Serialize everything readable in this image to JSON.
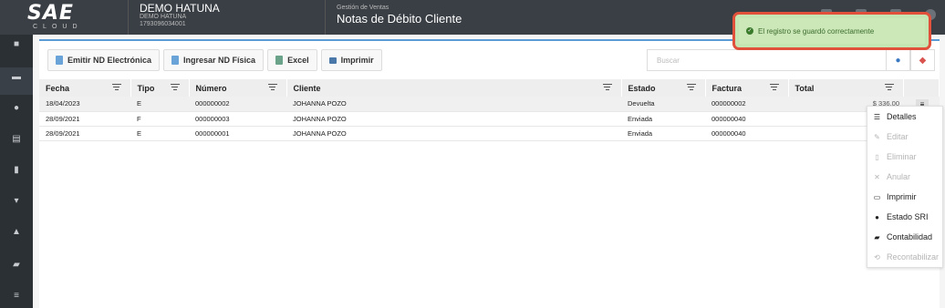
{
  "logo": {
    "main": "SAE",
    "sub": "CLOUD"
  },
  "company": {
    "name": "DEMO HATUNA",
    "sub_name": "DEMO HATUNA",
    "ruc": "1793096034001"
  },
  "module": {
    "section": "Gestión de Ventas",
    "title": "Notas de Débito Cliente"
  },
  "toolbar": {
    "emit_label": "Emitir ND Electrónica",
    "physical_label": "Ingresar ND Física",
    "excel_label": "Excel",
    "print_label": "Imprimir"
  },
  "search": {
    "placeholder": "Buscar"
  },
  "table": {
    "headers": [
      "Fecha",
      "Tipo",
      "Número",
      "Cliente",
      "Estado",
      "Factura",
      "Total"
    ],
    "rows": [
      {
        "fecha": "18/04/2023",
        "tipo": "E",
        "numero": "000000002",
        "cliente": "JOHANNA POZO",
        "estado": "Devuelta",
        "factura": "000000002",
        "total": "$ 336.00"
      },
      {
        "fecha": "28/09/2021",
        "tipo": "F",
        "numero": "000000003",
        "cliente": "JOHANNA POZO",
        "estado": "Enviada",
        "factura": "000000040",
        "total": ""
      },
      {
        "fecha": "28/09/2021",
        "tipo": "E",
        "numero": "000000001",
        "cliente": "JOHANNA POZO",
        "estado": "Enviada",
        "factura": "000000040",
        "total": ""
      }
    ]
  },
  "toast": {
    "message": "El registro se guardó correctamente"
  },
  "context_menu": {
    "items": [
      {
        "label": "Detalles",
        "icon": "list-icon"
      },
      {
        "label": "Editar",
        "icon": "pencil-icon"
      },
      {
        "label": "Eliminar",
        "icon": "trash-icon"
      },
      {
        "label": "Anular",
        "icon": "close-icon"
      },
      {
        "label": "Imprimir",
        "icon": "printer-icon"
      },
      {
        "label": "Estado SRI",
        "icon": "globe-icon"
      },
      {
        "label": "Contabilidad",
        "icon": "book-icon"
      },
      {
        "label": "Recontabilizar",
        "icon": "refresh-icon"
      }
    ]
  },
  "colors": {
    "accent": "#5b9bd5",
    "toast_border": "#e0503a",
    "toast_bg": "#c5e5b2",
    "topbar": "#3a3f45"
  }
}
